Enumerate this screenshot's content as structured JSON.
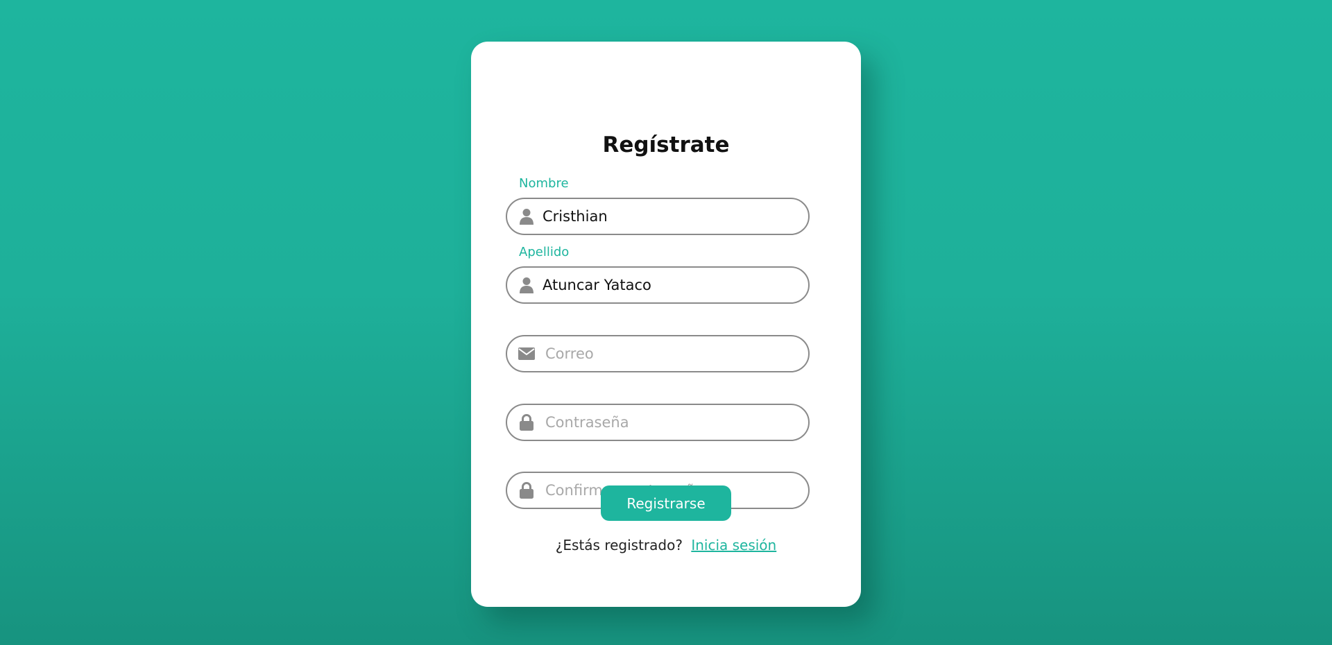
{
  "form": {
    "title": "Regístrate",
    "fields": [
      {
        "label": "Nombre",
        "value": "Cristhian",
        "placeholder": "",
        "icon": "user-icon"
      },
      {
        "label": "Apellido",
        "value": "Atuncar Yataco",
        "placeholder": "",
        "icon": "user-icon"
      },
      {
        "label": "",
        "value": "",
        "placeholder": "Correo",
        "icon": "envelope-icon"
      },
      {
        "label": "",
        "value": "",
        "placeholder": "Contraseña",
        "icon": "lock-icon"
      },
      {
        "label": "",
        "value": "",
        "placeholder": "Confirmar contraseña",
        "icon": "lock-icon"
      }
    ],
    "submit_label": "Registrarse",
    "footer_text": "¿Estás registrado?",
    "footer_link": "Inicia sesión"
  },
  "colors": {
    "accent": "#1eb59e",
    "background_top": "#1eb59e",
    "background_bottom": "#17937f",
    "field_border": "#8a8a8a",
    "icon": "#8a8a8a",
    "placeholder": "#a8a8a8"
  }
}
